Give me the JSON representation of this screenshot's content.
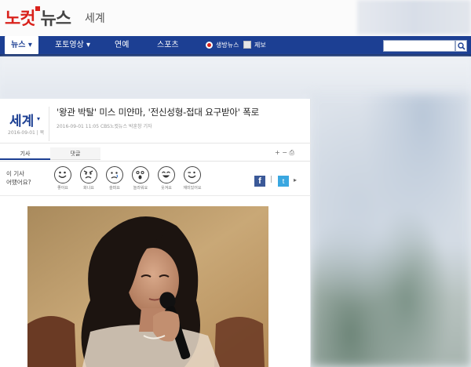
{
  "brand": {
    "part1": "노컷",
    "part2": "뉴스"
  },
  "header": {
    "section": "세계"
  },
  "nav": {
    "items": [
      {
        "label": "뉴스 ▾"
      },
      {
        "label": "포토영상 ▾"
      },
      {
        "label": "연예"
      },
      {
        "label": "스포츠"
      },
      {
        "label": "생방뉴스"
      },
      {
        "label": "제보"
      }
    ],
    "search_placeholder": ""
  },
  "article": {
    "section_label": "세계",
    "section_caret": "▾",
    "section_date": "2016-09-01 | 목",
    "headline": "'왕관 박탈' 미스 미얀마, '전신성형-접대 요구받아' 폭로",
    "byline": "2016-09-01 11:05    CBS노컷뉴스 박훈창 기자",
    "tabs": [
      {
        "label": "기사"
      },
      {
        "label": "댓글"
      }
    ],
    "font_tools": "+  −  ⎙",
    "reaction_question_line1": "이 기사",
    "reaction_question_line2": "어땠어요?",
    "reactions": [
      {
        "label": "좋아요",
        "icon": "like-face-icon"
      },
      {
        "label": "화나요",
        "icon": "angry-face-icon"
      },
      {
        "label": "슬퍼요",
        "icon": "sad-face-icon"
      },
      {
        "label": "놀라워요",
        "icon": "surprised-face-icon"
      },
      {
        "label": "웃겨요",
        "icon": "laugh-face-icon"
      },
      {
        "label": "재미있어요",
        "icon": "wink-face-icon"
      }
    ],
    "share": {
      "facebook": "f",
      "twitter": "t",
      "sep": "|",
      "more": "▸"
    }
  },
  "colors": {
    "nav_blue": "#1c3f93",
    "brand_red": "#d9221c"
  }
}
